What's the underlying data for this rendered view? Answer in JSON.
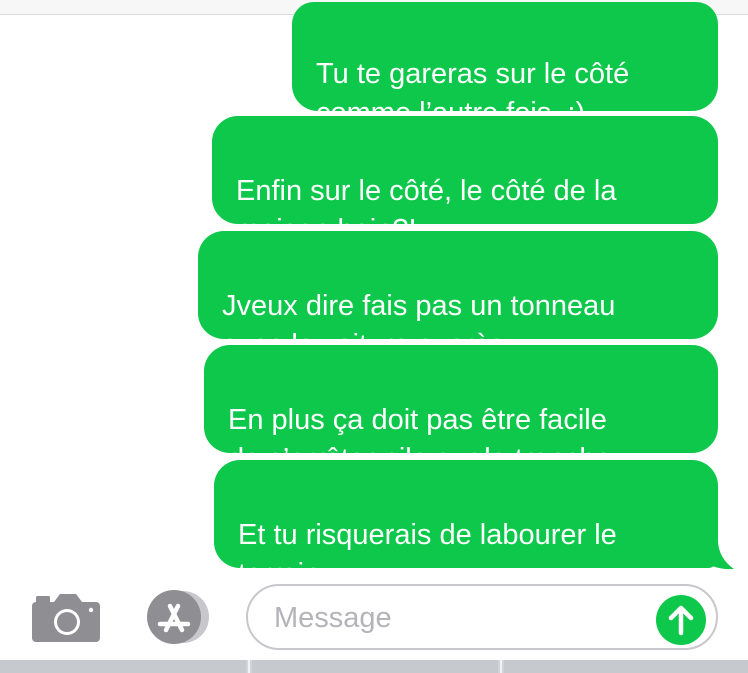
{
  "conversation": {
    "messages": [
      {
        "sender": "me",
        "text": "Tu te gareras sur le côté\ncomme l’autre fois. :)"
      },
      {
        "sender": "me",
        "text": "Enfin sur le côté, le côté de la\nmaison hein?!"
      },
      {
        "sender": "me",
        "text": "Jveux dire fais pas un tonneau\navec la voiture exprès."
      },
      {
        "sender": "me",
        "text": "En plus ça doit pas être facile\nde s’arrêter pile sur la tranche."
      },
      {
        "sender": "me",
        "text": "Et tu risquerais de labourer le\nterrain"
      }
    ],
    "bubble_color": "#0dc84a"
  },
  "input_bar": {
    "placeholder": "Message",
    "camera_icon": "camera-icon",
    "apps_icon": "app-store-icon",
    "send_icon": "arrow-up-icon",
    "send_color": "#0dc84a"
  }
}
